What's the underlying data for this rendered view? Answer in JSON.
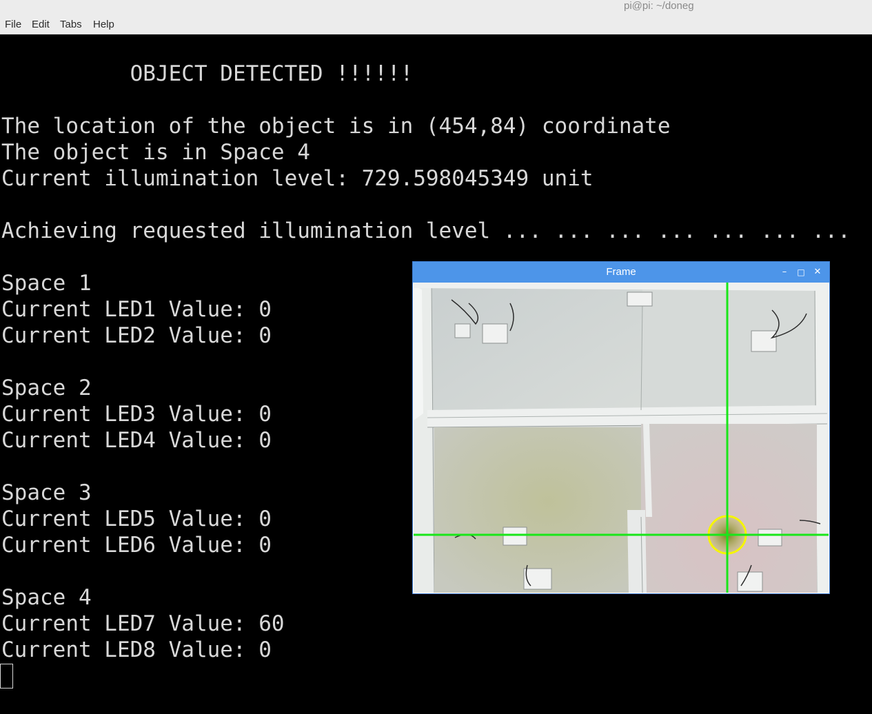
{
  "window": {
    "title": "pi@pi: ~/doneg"
  },
  "menu": {
    "file": "File",
    "edit": "Edit",
    "tabs": "Tabs",
    "help": "Help"
  },
  "terminal": {
    "lines": [
      "          OBJECT DETECTED !!!!!!",
      "",
      "The location of the object is in (454,84) coordinate",
      "The object is in Space 4",
      "Current illumination level: 729.598045349 unit",
      "",
      "Achieving requested illumination level ... ... ... ... ... ... ...",
      "",
      "Space 1",
      "Current LED1 Value: 0",
      "Current LED2 Value: 0",
      "",
      "Space 2",
      "Current LED3 Value: 0",
      "Current LED4 Value: 0",
      "",
      "Space 3",
      "Current LED5 Value: 0",
      "Current LED6 Value: 0",
      "",
      "Space 4",
      "Current LED7 Value: 60",
      "Current LED8 Value: 0"
    ]
  },
  "frame_window": {
    "title": "Frame",
    "minimize_glyph": "–",
    "maximize_glyph": "□",
    "close_glyph": "✕",
    "crosshair_color": "#19e619",
    "marker_color": "#f5f500"
  },
  "colors": {
    "terminal_bg": "#000000",
    "terminal_fg": "#d8d8d8",
    "frame_title_bg": "#4d95e9"
  }
}
